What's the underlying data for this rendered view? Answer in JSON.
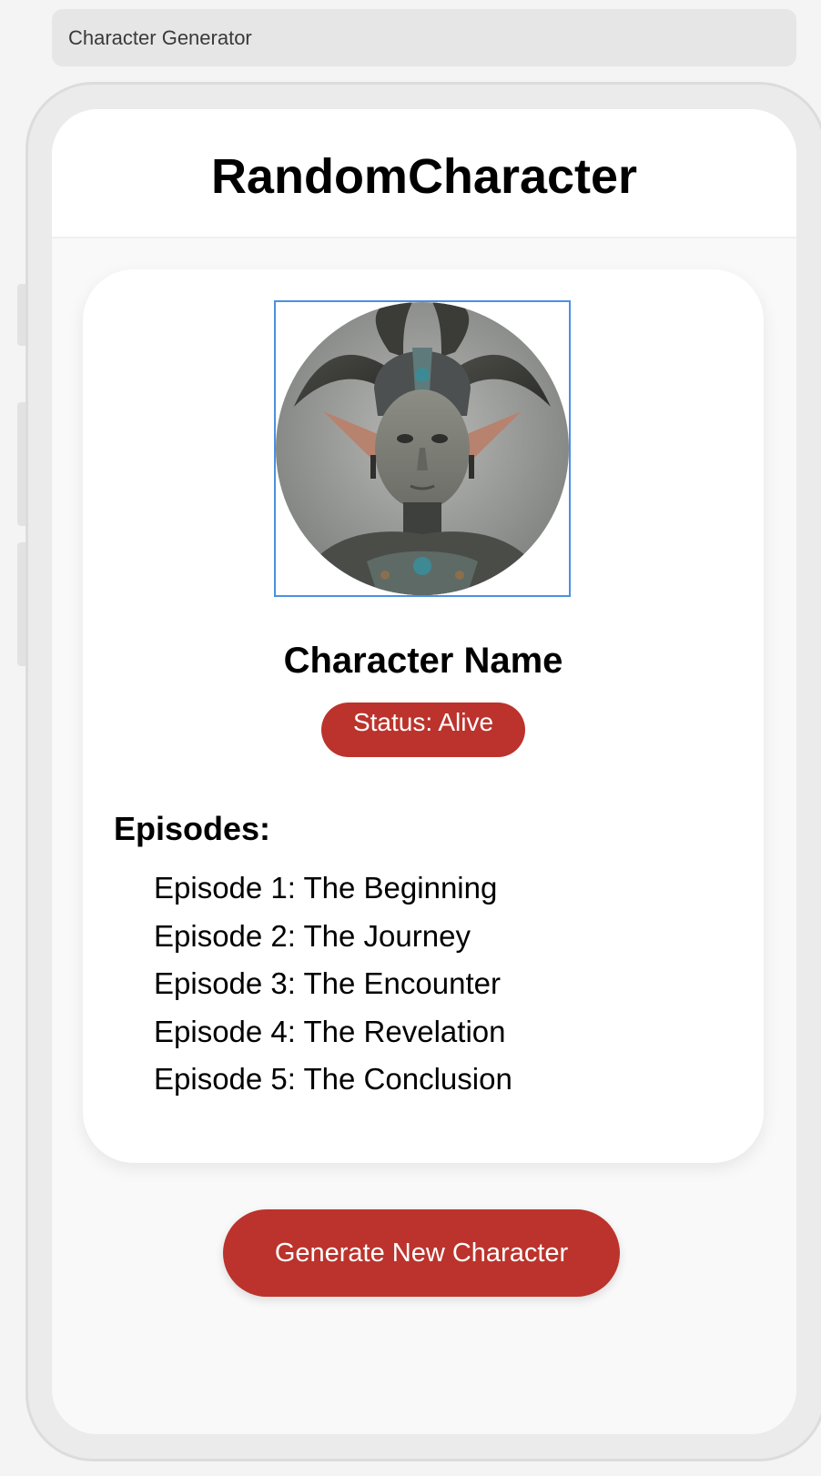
{
  "browser": {
    "tab_title": "Character Generator"
  },
  "app": {
    "title": "RandomCharacter"
  },
  "character": {
    "image_icon": "character-portrait-image",
    "name": "Character Name",
    "status": "Status: Alive"
  },
  "episodes": {
    "heading": "Episodes:",
    "items": [
      "Episode 1: The Beginning",
      "Episode 2: The Journey",
      "Episode 3: The Encounter",
      "Episode 4: The Revelation",
      "Episode 5: The Conclusion"
    ]
  },
  "actions": {
    "generate_label": "Generate New Character"
  },
  "colors": {
    "accent": "#bb332c",
    "selection_border": "#4a90e2",
    "background": "#f4f4f4"
  }
}
